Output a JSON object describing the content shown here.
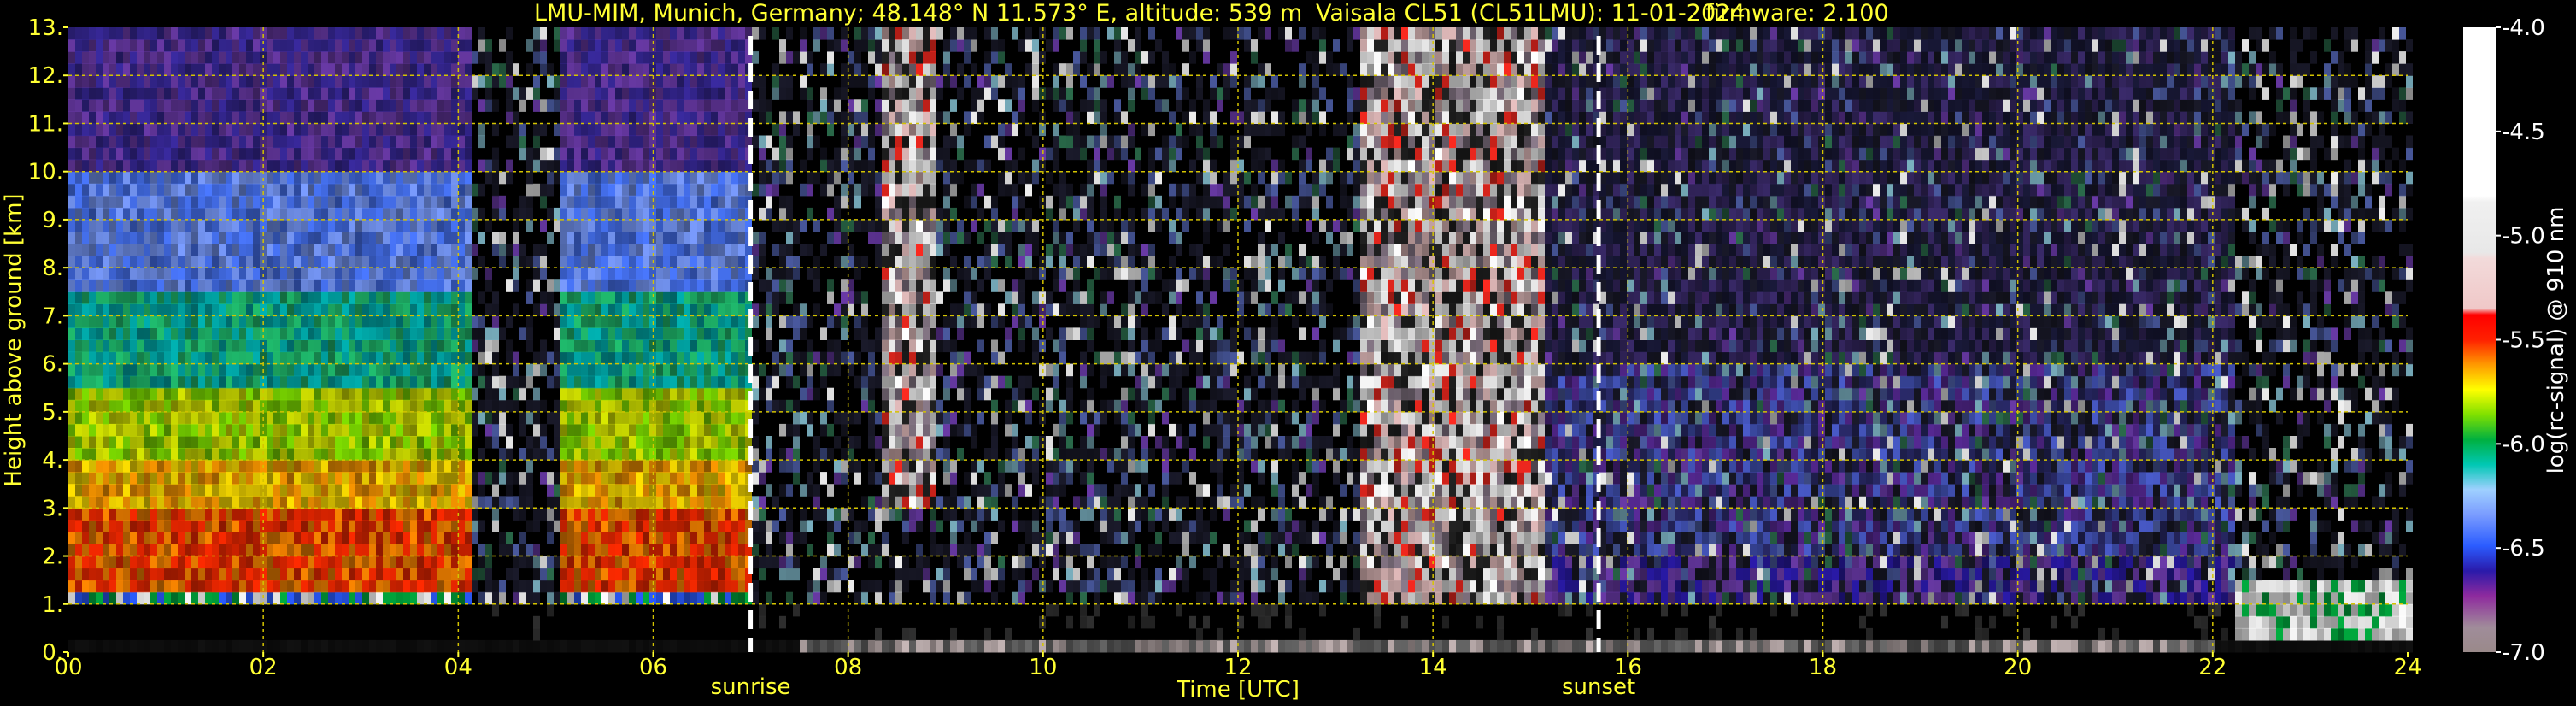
{
  "chart_data": {
    "type": "heatmap",
    "title_parts": {
      "location": "LMU-MIM, Munich, Germany; 48.148° N 11.573° E, altitude: 539 m",
      "instrument": "Vaisala CL51 (CL51LMU): 11-01-2024",
      "firmware": "firmware: 2.100"
    },
    "xlabel": "Time [UTC]",
    "ylabel": "Height above ground [km]",
    "xlim": [
      0,
      24
    ],
    "ylim": [
      0,
      13
    ],
    "x_ticks": [
      "00",
      "02",
      "04",
      "06",
      "08",
      "10",
      "12",
      "14",
      "16",
      "18",
      "20",
      "22",
      "24"
    ],
    "y_ticks": [
      "0.",
      "1.",
      "2.",
      "3.",
      "4.",
      "5.",
      "6.",
      "7.",
      "8.",
      "9.",
      "10.",
      "11.",
      "12.",
      "13."
    ],
    "grid": true,
    "grid_color": "#d4c400",
    "events": [
      {
        "label": "sunrise",
        "time": 7.0
      },
      {
        "label": "sunset",
        "time": 15.7
      }
    ],
    "colorbar": {
      "label": "log(rc-signal) @ 910 nm",
      "ticks": [
        "-4.0",
        "-4.5",
        "-5.0",
        "-5.5",
        "-6.0",
        "-6.5",
        "-7.0"
      ],
      "range": [
        -7.0,
        -4.0
      ]
    },
    "features": [
      {
        "name": "aerosol layer",
        "start": 0.0,
        "end": 4.1,
        "base_km": 1.0,
        "top_km": 13.0,
        "peak_km": 2.5
      },
      {
        "name": "aerosol layer",
        "start": 5.0,
        "end": 7.0,
        "base_km": 1.0,
        "top_km": 13.0,
        "peak_km": 2.5
      },
      {
        "name": "noise",
        "start": 8.3,
        "end": 8.9,
        "base_km": 3.0,
        "top_km": 13.0
      },
      {
        "name": "noise",
        "start": 13.2,
        "end": 15.1,
        "base_km": 1.0,
        "top_km": 13.0
      },
      {
        "name": "low cloud",
        "start": 22.2,
        "end": 24.0,
        "base_km": 0.3,
        "top_km": 1.5
      }
    ]
  },
  "colors": {
    "background": "#000000",
    "text": "#ffff33",
    "event_line": "#ffffff"
  }
}
